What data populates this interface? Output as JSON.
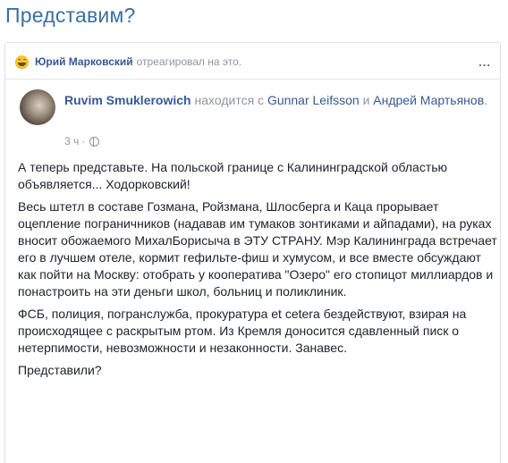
{
  "heading": "Представим?",
  "reaction": {
    "icon": "laughing-emoji-icon",
    "user": "Юрий Марковский",
    "action": "отреагировал на это.",
    "menu": "..."
  },
  "post": {
    "author": "Ruvim Smuklerowich",
    "with_text": "находится с",
    "tagged_1": "Gunnar Leifsson",
    "and": "и",
    "tagged_2": "Андрей Мартьянов",
    "time": "3 ч",
    "dot": "·",
    "paragraphs": [
      "А теперь представьте. На польской границе с Калининградской областью объявляется... Ходорковский!",
      "Весь штетл в составе Гозмана, Ройзмана, Шлосберга и Каца прорывает оцепление пограничников (надавав им тумаков зонтиками и айпадами), на руках вносит обожаемого МихалБорисыча в ЭТУ СТРАНУ. Мэр Калининграда встречает его в лучшем отеле, кормит гефильте-фиш и хумусом, и все вместе обсуждают как пойти на Москву: отобрать у кооператива \"Озеро\" его стопицот миллиардов и понастроить на эти деньги школ, больниц и поликлиник.",
      "ФСБ, полиция, погранслужба, прокуратура et cetera бездействуют, взирая на происходящее с раскрытым ртом. Из Кремля доносится сдавленный писк о нетерпимости, невозможности и незаконности. Занавес.",
      "Представили?"
    ]
  }
}
